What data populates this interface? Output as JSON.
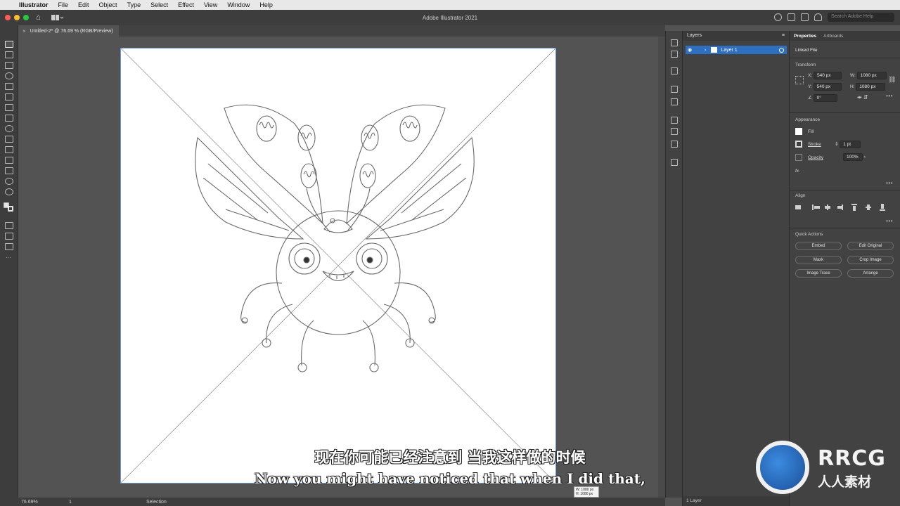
{
  "menubar": {
    "app_name": "Illustrator",
    "items": [
      "File",
      "Edit",
      "Object",
      "Type",
      "Select",
      "Effect",
      "View",
      "Window",
      "Help"
    ]
  },
  "titlebar": {
    "title": "Adobe Illustrator 2021",
    "search_placeholder": "Search Adobe Help"
  },
  "document": {
    "tab_label": "Untitled-2* @ 76.69 % (RGB/Preview)"
  },
  "layers": {
    "panel_title": "Layers",
    "layer_name": "Layer 1",
    "footer": "1 Layer"
  },
  "properties": {
    "tab_properties": "Properties",
    "tab_artboards": "Artboards",
    "linked_file": "Linked File",
    "transform_title": "Transform",
    "x_label": "X:",
    "x_value": "540 px",
    "y_label": "Y:",
    "y_value": "540 px",
    "w_label": "W:",
    "w_value": "1080 px",
    "h_label": "H:",
    "h_value": "1080 px",
    "angle_value": "0°",
    "appearance_title": "Appearance",
    "fill_label": "Fill",
    "stroke_label": "Stroke",
    "stroke_value": "1 pt",
    "opacity_label": "Opacity",
    "opacity_value": "100%",
    "fx_label": "fx.",
    "align_title": "Align",
    "quick_actions_title": "Quick Actions",
    "buttons": {
      "embed": "Embed",
      "edit_original": "Edit Original",
      "mask": "Mask",
      "crop_image": "Crop Image",
      "image_trace": "Image Trace",
      "arrange": "Arrange"
    }
  },
  "statusbar": {
    "zoom": "76.69%",
    "page": "1",
    "tool": "Selection"
  },
  "tooltip": {
    "w": "W: 1080 px",
    "h": "H: 1080 px"
  },
  "subtitles": {
    "chinese": "现在你可能已经注意到 当我这样做的时候",
    "english": "Now you might have noticed that when I did that,"
  },
  "watermark": {
    "brand": "RRCG",
    "brand_cn": "人人素材"
  },
  "colors": {
    "accent_selection": "#2f6fbf",
    "traffic_red": "#ff5f57",
    "traffic_yellow": "#febc2e",
    "traffic_green": "#28c840"
  }
}
